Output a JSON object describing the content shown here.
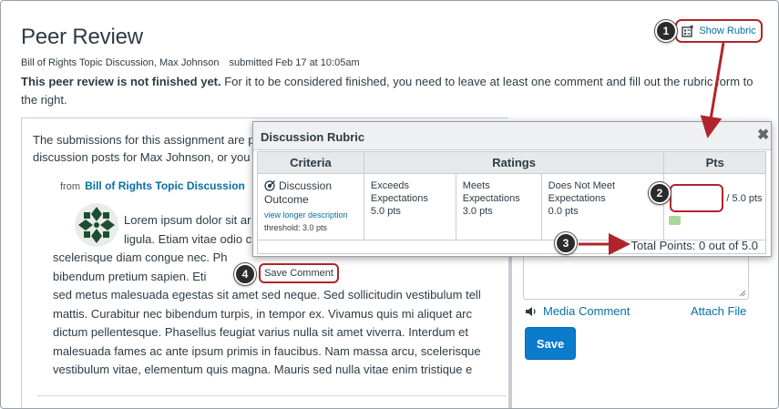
{
  "page": {
    "title": "Peer Review",
    "assignment_meta": "Bill of Rights Topic Discussion, Max Johnson",
    "submitted": "submitted Feb 17 at 10:05am",
    "notice_bold": "This peer review is not finished yet.",
    "notice_rest": " For it to be considered finished, you need to leave at least one comment and fill out the rubric form to the right.",
    "show_rubric_label": "Show Rubric"
  },
  "submission": {
    "intro": "The submissions for this assignment are p… discussion posts for Max Johnson, or you…",
    "intro_line1": "The submissions for this assignment are p",
    "intro_line2": "discussion posts for Max Johnson, or you",
    "from_label": "from",
    "from_link": "Bill of Rights Topic Discussion",
    "lines": [
      "Lorem ipsum dolor sit ar",
      "ligula. Etiam vitae odio c",
      "scelerisque diam congue nec. Ph",
      "bibendum pretium sapien. Eti",
      "sed metus malesuada egestas sit amet sed neque. Sed sollicitudin vestibulum tell",
      "mattis. Curabitur nec bibendum turpis, in tempor ex. Vivamus quis mi aliquet arc",
      "dictum pellentesque. Phasellus feugiat varius nulla sit amet viverra. Interdum et",
      "malesuada fames ac ante ipsum primis in faucibus. Nam massa arcu, scelerisque",
      "vestibulum vitae, elementum quis magna. Mauris sed nulla vitae enim tristique e"
    ]
  },
  "rubric": {
    "title": "Discussion Rubric",
    "close_icon": "✖",
    "headers": [
      "Criteria",
      "Ratings",
      "Pts"
    ],
    "criterion": {
      "name_line1": "Discussion",
      "name_line2": "Outcome",
      "link": "view longer description",
      "threshold": "threshold: 3.0 pts"
    },
    "ratings": [
      {
        "line1": "Exceeds",
        "line2": "Expectations",
        "pts": "5.0 pts"
      },
      {
        "line1": "Meets",
        "line2": "Expectations",
        "pts": "3.0 pts"
      },
      {
        "line1": "Does Not Meet",
        "line2": "Expectations",
        "pts": "0.0 pts"
      }
    ],
    "points_value": "",
    "points_of": "/ 5.0 pts",
    "total": "Total Points: 0 out of 5.0",
    "save_comment": "Save Comment"
  },
  "comment_panel": {
    "media_comment": "Media Comment",
    "attach_file": "Attach File",
    "save": "Save"
  },
  "callouts": [
    "1",
    "2",
    "3",
    "4"
  ],
  "colors": {
    "highlight": "#b0252b",
    "link": "#0770a3",
    "primary_button": "#0b7bcc",
    "callout_bg": "#2b2b2b"
  }
}
